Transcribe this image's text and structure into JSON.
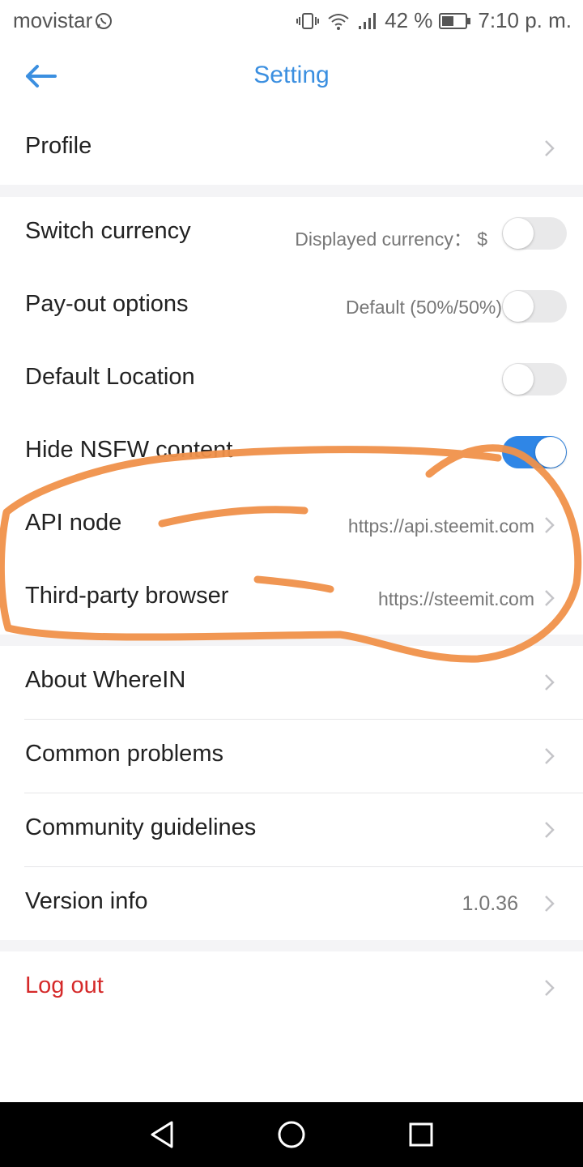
{
  "status_bar": {
    "carrier": "movistar",
    "battery": "42 %",
    "time": "7:10 p. m."
  },
  "header": {
    "title": "Setting"
  },
  "settings": {
    "profile": {
      "label": "Profile"
    },
    "switch_currency": {
      "label": "Switch currency",
      "value": "Displayed currency： $",
      "enabled": false
    },
    "payout_options": {
      "label": "Pay-out options",
      "value": "Default (50%/50%)",
      "enabled": false
    },
    "default_location": {
      "label": "Default Location",
      "enabled": false
    },
    "hide_nsfw": {
      "label": "Hide NSFW content",
      "enabled": true
    },
    "api_node": {
      "label": "API node",
      "value": "https://api.steemit.com"
    },
    "third_party_browser": {
      "label": "Third-party browser",
      "value": "https://steemit.com"
    },
    "about": {
      "label": "About WhereIN"
    },
    "common_problems": {
      "label": "Common problems"
    },
    "community_guidelines": {
      "label": "Community guidelines"
    },
    "version_info": {
      "label": "Version info",
      "value": "1.0.36"
    },
    "log_out": {
      "label": "Log out"
    }
  },
  "colors": {
    "accent": "#3b8fe0",
    "toggle_on": "#2f86e6",
    "danger": "#d52a2a",
    "annotation": "#f0914a"
  },
  "icons": {
    "back": "arrow-left-icon",
    "chevron": "chevron-right-icon",
    "nav_back": "triangle-back-icon",
    "nav_home": "circle-home-icon",
    "nav_recents": "square-recents-icon"
  }
}
